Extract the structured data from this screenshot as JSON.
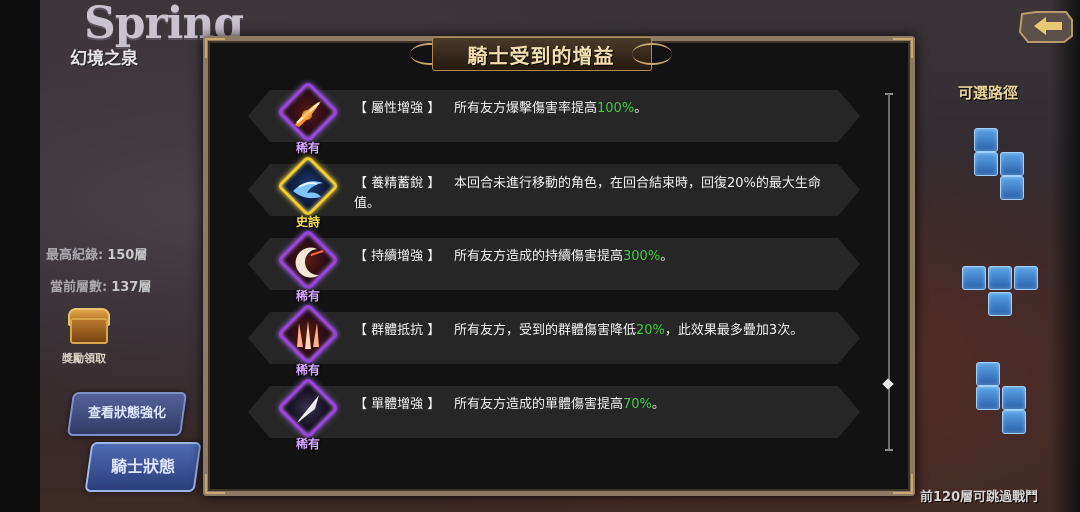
{
  "background": {
    "logo_main": "Spring",
    "logo_sub": "幻境之泉",
    "stats": [
      {
        "label": "最高紀錄:",
        "value": "150層"
      },
      {
        "label": "當前層數:",
        "value": "137層"
      }
    ],
    "reward_label": "獎勵領取",
    "buttons": {
      "view_buffs": "查看狀態強化",
      "knight_status": "騎士狀態"
    },
    "routes_title": "可選路徑",
    "bottom_note": "前120層可跳過戰鬥"
  },
  "modal": {
    "title": "騎士受到的增益",
    "buffs": [
      {
        "rarity": "稀有",
        "rarity_type": "rare",
        "icon": "fire-sword-icon",
        "name": "【 屬性增強 】",
        "desc_pre": "所有友方爆擊傷害率提高",
        "desc_hl": "100%",
        "desc_post": "。"
      },
      {
        "rarity": "史詩",
        "rarity_type": "epic",
        "icon": "wind-recovery-icon",
        "name": "【 養精蓄銳 】",
        "desc_full": "本回合未進行移動的角色，在回合結束時，回復20%的最大生命值。"
      },
      {
        "rarity": "稀有",
        "rarity_type": "rare",
        "icon": "moon-slash-icon",
        "name": "【 持續增強 】",
        "desc_pre": "所有友方造成的持續傷害提高",
        "desc_hl": "300%",
        "desc_post": "。"
      },
      {
        "rarity": "稀有",
        "rarity_type": "rare",
        "icon": "triple-claw-icon",
        "name": "【 群體抵抗 】",
        "desc_pre": "所有友方，受到的群體傷害降低",
        "desc_hl": "20%",
        "desc_post": "，此效果最多疊加3次。"
      },
      {
        "rarity": "稀有",
        "rarity_type": "rare",
        "icon": "single-blade-icon",
        "name": "【 單體增強 】",
        "desc_pre": "所有友方造成的單體傷害提高",
        "desc_hl": "70%",
        "desc_post": "。"
      }
    ]
  },
  "colors": {
    "highlight": "#3fcc3f",
    "rare": "#9b45e0",
    "epic": "#f2cf2c",
    "frame": "#8d7b66"
  }
}
